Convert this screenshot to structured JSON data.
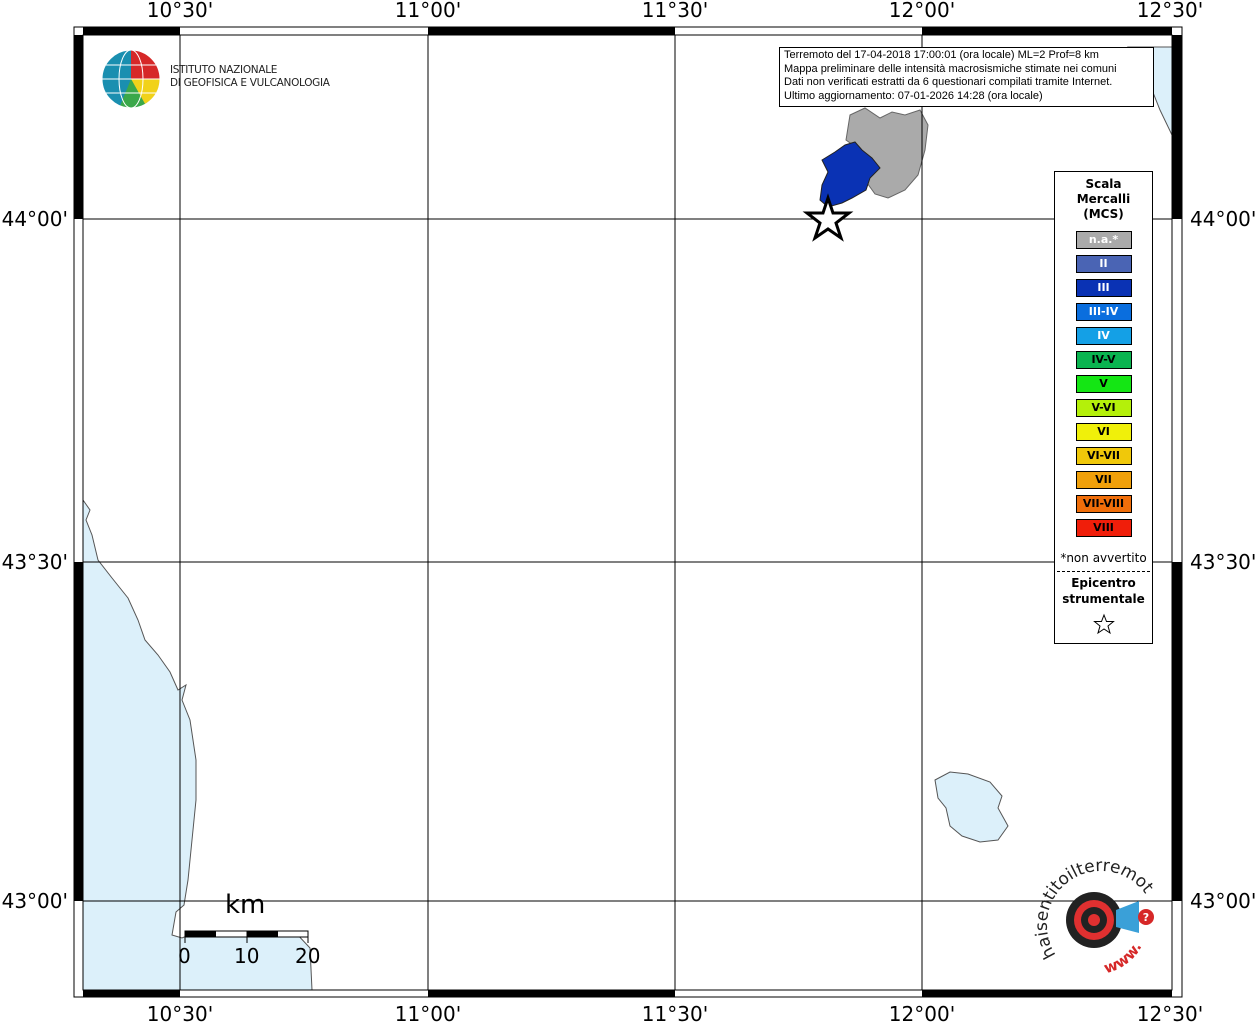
{
  "map": {
    "lon_labels": [
      "10°30'",
      "11°00'",
      "11°30'",
      "12°00'",
      "12°30'"
    ],
    "lat_labels": [
      "44°00'",
      "43°30'",
      "43°00'"
    ]
  },
  "info": {
    "line1": "Terremoto del 17-04-2018 17:00:01 (ora locale) ML=2 Prof=8 km",
    "line2": "Mappa preliminare delle intensità macrosismiche stimate nei comuni",
    "line3": "Dati non verificati estratti da 6 questionari compilati tramite Internet.",
    "line4": "Ultimo aggiornamento: 07-01-2026 14:28 (ora locale)"
  },
  "legend": {
    "title_lines": [
      "Scala",
      "Mercalli",
      "(MCS)"
    ],
    "items": [
      {
        "label": "n.a.*",
        "color": "#aaaaaa",
        "text_color": "#ffffff"
      },
      {
        "label": "II",
        "color": "#4a64b4",
        "text_color": "#ffffff"
      },
      {
        "label": "III",
        "color": "#0a32b4",
        "text_color": "#ffffff"
      },
      {
        "label": "III-IV",
        "color": "#0a6ede",
        "text_color": "#ffffff"
      },
      {
        "label": "IV",
        "color": "#14a0e6",
        "text_color": "#ffffff"
      },
      {
        "label": "IV-V",
        "color": "#0ab450",
        "text_color": "#000000"
      },
      {
        "label": "V",
        "color": "#14e614",
        "text_color": "#000000"
      },
      {
        "label": "V-VI",
        "color": "#b4f00a",
        "text_color": "#000000"
      },
      {
        "label": "VI",
        "color": "#f0f00a",
        "text_color": "#000000"
      },
      {
        "label": "VI-VII",
        "color": "#f0c80a",
        "text_color": "#000000"
      },
      {
        "label": "VII",
        "color": "#f0a00a",
        "text_color": "#000000"
      },
      {
        "label": "VII-VIII",
        "color": "#f06e0a",
        "text_color": "#000000"
      },
      {
        "label": "VIII",
        "color": "#f01e0a",
        "text_color": "#000000"
      }
    ],
    "note": "*non avvertito",
    "epicentre_lines": [
      "Epicentro",
      "strumentale"
    ]
  },
  "logo": {
    "ingv_line1": "ISTITUTO NAZIONALE",
    "ingv_line2": "DI GEOFISICA E VULCANOLOGIA",
    "haisentito_text": "haisentitoilterremoto.it",
    "haisentito_www": "www."
  },
  "scalebar": {
    "unit": "km",
    "ticks": [
      "0",
      "10",
      "20"
    ]
  },
  "colors": {
    "sea": "#dcf0fa",
    "intensity_na": "#aaaaaa",
    "intensity_III": "#0a32b4"
  }
}
